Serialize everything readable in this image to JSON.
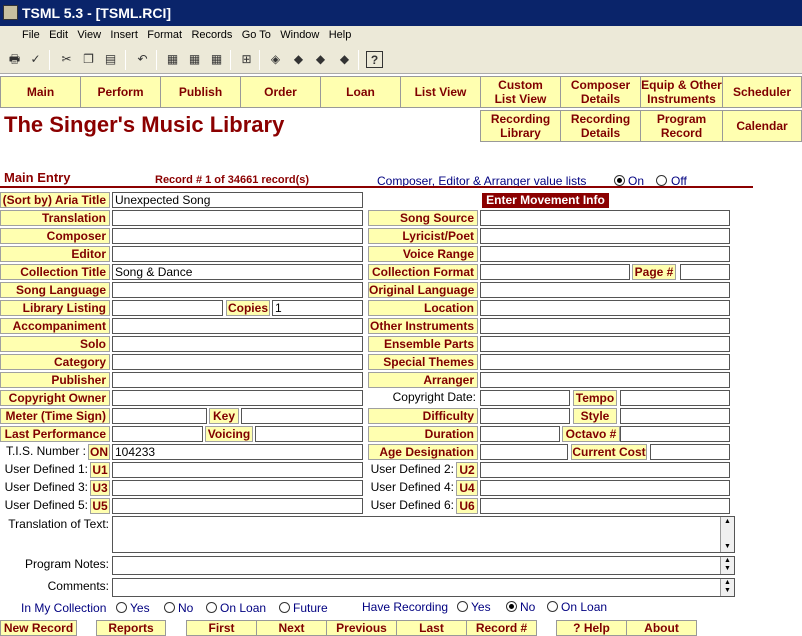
{
  "window": {
    "title": "TSML 5.3 - [TSML.RCI]"
  },
  "menu": [
    "File",
    "Edit",
    "View",
    "Insert",
    "Format",
    "Records",
    "Go To",
    "Window",
    "Help"
  ],
  "toolbar": {
    "icons": [
      "print-icon",
      "spell-icon",
      "cut-icon",
      "copy-icon",
      "paste-icon",
      "undo-icon",
      "sort-ascending-icon",
      "sort-descending-icon",
      "filter-icon",
      "find-icon",
      "new-record-icon",
      "apply-filter-icon",
      "edit-filter-icon",
      "remove-filter-icon",
      "help-icon"
    ]
  },
  "nav_row1": [
    "Main",
    "Perform",
    "Publish",
    "Order",
    "Loan",
    "List View",
    "Custom List View",
    "Composer Details",
    "Equip & Other Instruments",
    "Scheduler"
  ],
  "nav_row2": [
    "Recording Library",
    "Recording Details",
    "Program Record",
    "Calendar"
  ],
  "app_title": "The Singer's Music Library",
  "section": {
    "title": "Main Entry",
    "record_info": "Record # 1 of 34661 record(s)",
    "value_lists_label": "Composer, Editor & Arranger value lists",
    "value_lists_on": "On",
    "value_lists_off": "Off",
    "value_lists_selected": "On"
  },
  "movement_button": "Enter Movement Info",
  "left_labels": [
    "(Sort by) Aria Title",
    "Translation",
    "Composer",
    "Editor",
    "Collection Title",
    "Song Language",
    "Library Listing",
    "Accompaniment",
    "Solo",
    "Category",
    "Publisher",
    "Copyright Owner",
    "Meter (Time Sign)",
    "Last Performance",
    "T.I.S. Number :",
    "User Defined 1:",
    "User Defined 3:",
    "User Defined 5:"
  ],
  "right_labels": [
    "Song Source",
    "Lyricist/Poet",
    "Voice Range",
    "Collection Format",
    "Original Language",
    "Location",
    "Other Instruments",
    "Ensemble Parts",
    "Special Themes",
    "Arranger",
    "Copyright Date:",
    "Difficulty",
    "Duration",
    "Age Designation",
    "User Defined 2:",
    "User Defined 4:",
    "User Defined 6:"
  ],
  "mini_labels": {
    "copies": "Copies",
    "key": "Key",
    "voicing": "Voicing",
    "on": "ON",
    "u1": "U1",
    "u2": "U2",
    "u3": "U3",
    "u4": "U4",
    "u5": "U5",
    "u6": "U6",
    "page": "Page #",
    "tempo": "Tempo",
    "style": "Style",
    "octavo": "Octavo #",
    "current_cost": "Current Cost"
  },
  "values": {
    "aria_title": "Unexpected Song",
    "collection_title": "Song & Dance",
    "copies": "1",
    "tis_number": "104233"
  },
  "text_areas": {
    "translation": "Translation of Text:",
    "program_notes": "Program Notes:",
    "comments": "Comments:"
  },
  "collection": {
    "label": "In My Collection",
    "options": [
      "Yes",
      "No",
      "On Loan",
      "Future"
    ]
  },
  "recording": {
    "label": "Have Recording",
    "options": [
      "Yes",
      "No",
      "On Loan"
    ],
    "selected": "No"
  },
  "bottom_buttons": [
    "New Record",
    "Reports",
    "First",
    "Next",
    "Previous",
    "Last",
    "Record #",
    "? Help",
    "About"
  ]
}
